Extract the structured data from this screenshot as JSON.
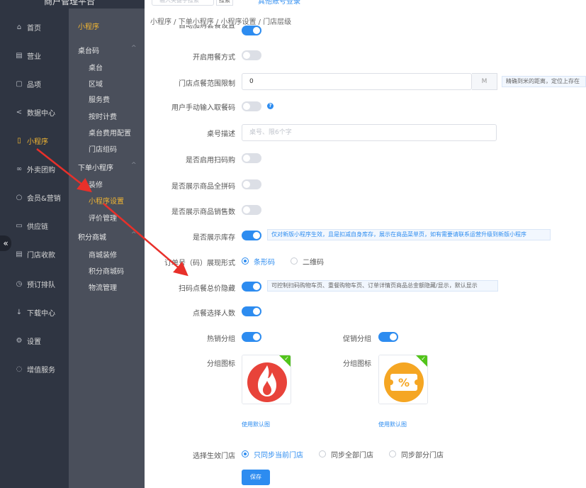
{
  "brand": "商户管理平台",
  "topbar": {
    "search_placeholder": "输入关键字搜索",
    "search_button": "搜索",
    "link": "其他账号登录"
  },
  "nav": {
    "items": [
      {
        "label": "首页",
        "icon": "home-icon",
        "glyph": "⌂"
      },
      {
        "label": "营业",
        "icon": "calendar-icon",
        "glyph": "▤"
      },
      {
        "label": "品项",
        "icon": "bag-icon",
        "glyph": "▢"
      },
      {
        "label": "数据中心",
        "icon": "share-icon",
        "glyph": "<"
      },
      {
        "label": "小程序",
        "icon": "phone-icon",
        "glyph": "▯"
      },
      {
        "label": "外卖团购",
        "icon": "bike-icon",
        "glyph": "∞"
      },
      {
        "label": "会员&营销",
        "icon": "user-icon",
        "glyph": "○"
      },
      {
        "label": "供应链",
        "icon": "truck-icon",
        "glyph": "▭"
      },
      {
        "label": "门店收款",
        "icon": "wallet-icon",
        "glyph": "▤"
      },
      {
        "label": "预订排队",
        "icon": "clock-icon",
        "glyph": "◷"
      },
      {
        "label": "下载中心",
        "icon": "download-icon",
        "glyph": "↓"
      },
      {
        "label": "设置",
        "icon": "gear-icon",
        "glyph": "⚙"
      },
      {
        "label": "增值服务",
        "icon": "alarm-icon",
        "glyph": "◌"
      }
    ],
    "collapse_glyph": "«"
  },
  "subnav": {
    "title": "小程序",
    "groups": [
      {
        "label": "桌台码",
        "items": [
          "桌台",
          "区域",
          "服务费",
          "按时计费",
          "桌台费用配置",
          "门店组码"
        ]
      },
      {
        "label": "下单小程序",
        "items": [
          "装修",
          "小程序设置",
          "评价管理"
        ]
      },
      {
        "label": "积分商城",
        "items": [
          "商城装修",
          "积分商城码",
          "物流管理"
        ]
      }
    ],
    "caret": "^"
  },
  "breadcrumb": "小程序 / 下单小程序 / 小程序设置 / 门店层级",
  "form": {
    "top_cut_label": "自动加购套餐设置",
    "enable_mode_label": "开启用餐方式",
    "range_label": "门店点餐范围限制",
    "range_value": "0",
    "range_unit": "M",
    "range_hint": "精确到米的距离，定位上存在",
    "manual_code_label": "用户手动输入取餐码",
    "table_desc_label": "桌号描述",
    "table_desc_placeholder": "桌号、限6个字",
    "scan_buy_label": "是否启用扫码购",
    "show_pinyin_label": "是否展示商品全拼码",
    "show_sales_label": "是否展示商品销售数",
    "show_stock_label": "是否展示库存",
    "show_stock_hint": "仅对新版小程序生效，且是扣减自身库存，展示在商品菜单页，如有需要请联系运营升级到新版小程序",
    "order_code_label": "订单号（码）展现形式",
    "barcode_label": "条形码",
    "qrcode_label": "二维码",
    "hide_total_label": "扫码点餐总价隐藏",
    "hide_total_hint": "可控制扫码购物车页、重餐购物车页、订单详情页商品总金额隐藏/显示，默认显示",
    "choose_people_label": "点餐选择人数",
    "hot_group_label": "热销分组",
    "promo_group_label": "促销分组",
    "group_icon_label": "分组图标",
    "group_icon_label_2": "分组图标",
    "use_default": "使用默认图",
    "use_default_2": "使用默认图",
    "effective_store_label": "选择生效门店",
    "sync_current": "只同步当前门店",
    "sync_all": "同步全部门店",
    "sync_partial": "同步部分门店",
    "save": "保存",
    "toggles": {
      "top_cut": true,
      "enable_mode": false,
      "manual_code": false,
      "scan_buy": false,
      "show_pinyin": false,
      "show_sales": false,
      "show_stock": true,
      "hide_total": true,
      "choose_people": true,
      "hot_group": true,
      "promo_group": true
    },
    "order_code_selected": "条形码",
    "sync_selected": "只同步当前门店",
    "hot_icon": "fire-icon",
    "promo_icon": "coupon-icon",
    "hot_icon_glyph": "🔥",
    "promo_icon_glyph": "%"
  },
  "colors": {
    "accent": "#2d8cf0",
    "active_nav": "#f2b632",
    "sidebar": "#2f3542",
    "subnav": "#4a4f5b",
    "hot_red": "#e8433a",
    "promo_orange": "#f5a623",
    "check_green": "#52c41a",
    "annotation_arrow": "#e8302a"
  }
}
